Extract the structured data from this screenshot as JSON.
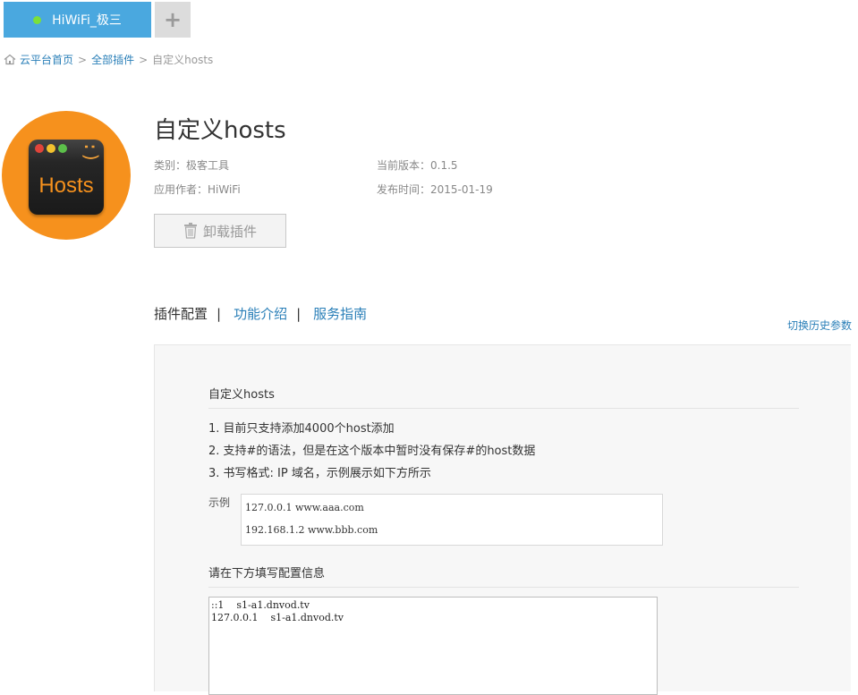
{
  "device_tab": {
    "label": "HiWiFi_极三",
    "status_color": "#7be03a"
  },
  "add_tab": {
    "label": "+"
  },
  "breadcrumb": {
    "home": "云平台首页",
    "sep": ">",
    "all_plugins": "全部插件",
    "current": "自定义hosts"
  },
  "plugin": {
    "logo_text": "Hosts",
    "logo_smiley": ":)",
    "title": "自定义hosts",
    "category": "类别：极客工具",
    "version": "当前版本：0.1.5",
    "author": "应用作者：HiWiFi",
    "release": "发布时间：2015-01-19",
    "uninstall_label": "卸载插件"
  },
  "tabs": {
    "config": "插件配置",
    "sep": "|",
    "intro": "功能介绍",
    "guide": "服务指南"
  },
  "history_link": "切换历史参数",
  "config": {
    "section_title": "自定义hosts",
    "tips": [
      "1. 目前只支持添加4000个host添加",
      "2. 支持#的语法，但是在这个版本中暂时没有保存#的host数据",
      "3. 书写格式: IP 域名，示例展示如下方所示"
    ],
    "example_label": "示例",
    "example_lines": [
      "127.0.0.1 www.aaa.com",
      "192.168.1.2 www.bbb.com"
    ],
    "input_title": "请在下方填写配置信息",
    "hosts_value": "::1    s1-a1.dnvod.tv\n127.0.0.1    s1-a1.dnvod.tv"
  },
  "colors": {
    "accent": "#4aa8df",
    "link": "#2a7fb8",
    "logo_orange": "#f6911d"
  }
}
